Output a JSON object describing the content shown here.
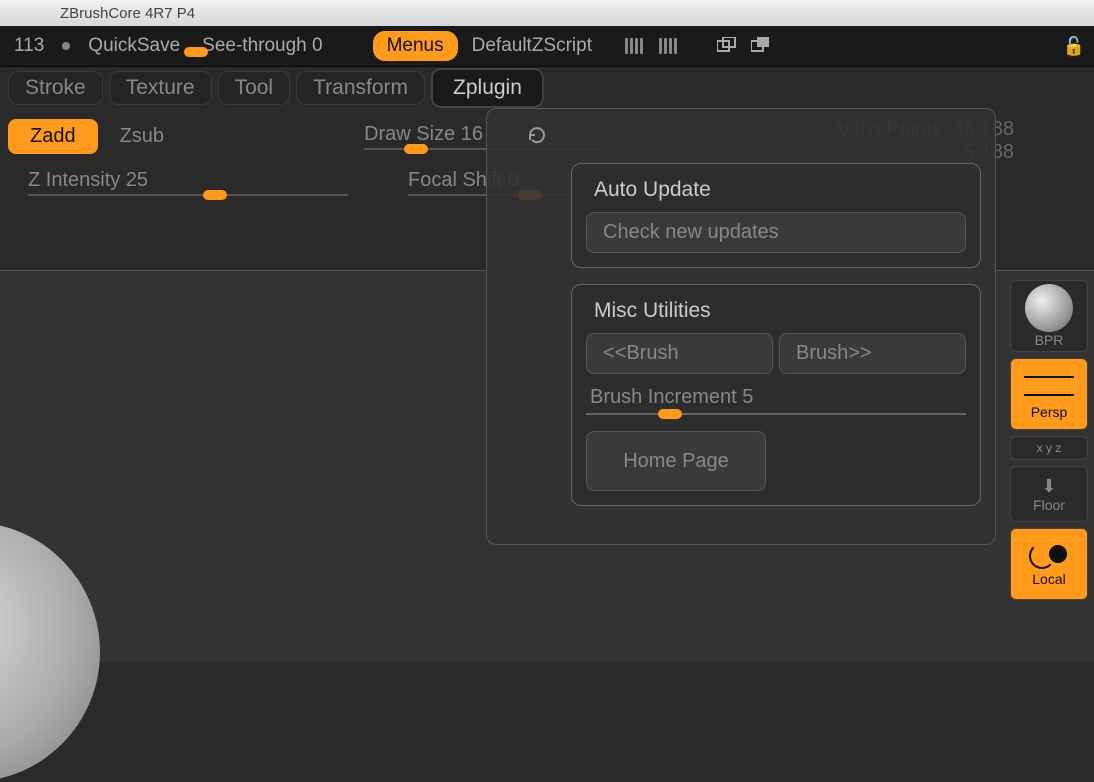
{
  "title": "ZBrushCore 4R7 P4",
  "top": {
    "field_value": "113",
    "quicksave": "QuickSave",
    "seethrough": "See-through  0",
    "menus": "Menus",
    "defaultzscript": "DefaultZScript"
  },
  "menus": [
    "Stroke",
    "Texture",
    "Tool",
    "Transform",
    "Zplugin"
  ],
  "tool": {
    "zadd": "Zadd",
    "zsub": "Zsub",
    "zintensity": "Z Intensity 25",
    "drawsize": "Draw Size 16",
    "focalshift": "Focal Shift 0"
  },
  "stats": {
    "activepoints_label": "ActivePoints:",
    "activepoints_value": "46,188",
    "secondary": "5,188"
  },
  "zplugin": {
    "auto_update": "Auto Update",
    "check": "Check new updates",
    "misc": "Misc Utilities",
    "prev": "<<Brush",
    "next": "Brush>>",
    "increment": "Brush Increment 5",
    "home": "Home Page"
  },
  "dock": {
    "bpr": "BPR",
    "persp": "Persp",
    "xyz": "x  y  z",
    "floor": "Floor",
    "local": "Local"
  }
}
